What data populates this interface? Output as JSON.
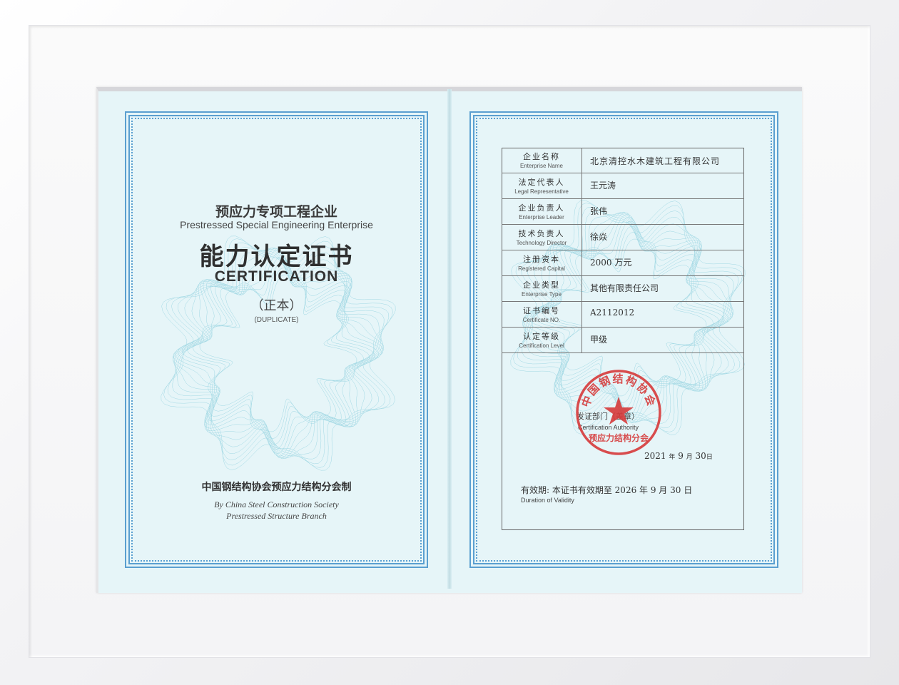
{
  "left_page": {
    "title_cn": "预应力专项工程企业",
    "title_en": "Prestressed Special Engineering Enterprise",
    "heading_cn": "能力认定证书",
    "heading_en": "CERTIFICATION",
    "copy_cn": "（正本）",
    "copy_en": "(DUPLICATE)",
    "issuer_cn": "中国钢结构协会预应力结构分会制",
    "issuer_en_line1": "By China Steel Construction Society",
    "issuer_en_line2": "Prestressed Structure Branch"
  },
  "right_page": {
    "rows": [
      {
        "label_cn": "企业名称",
        "label_en": "Enterprise Name",
        "value": "北京清控水木建筑工程有限公司"
      },
      {
        "label_cn": "法定代表人",
        "label_en": "Legal Representative",
        "value": "王元涛"
      },
      {
        "label_cn": "企业负责人",
        "label_en": "Enterprise Leader",
        "value": "张伟"
      },
      {
        "label_cn": "技术负责人",
        "label_en": "Technology Director",
        "value": "徐焱"
      },
      {
        "label_cn": "注册资本",
        "label_en": "Registered Capital",
        "value": "2000 万元"
      },
      {
        "label_cn": "企业类型",
        "label_en": "Enterprise Type",
        "value": "其他有限责任公司"
      },
      {
        "label_cn": "证书编号",
        "label_en": "Certificate NO.",
        "value": "A2112012"
      },
      {
        "label_cn": "认定等级",
        "label_en": "Certification Level",
        "value": "甲级"
      }
    ],
    "authority_cn": "发证部门（盖章）",
    "authority_en": "Certification Authority",
    "issue_date": {
      "year": "2021",
      "year_unit": "年",
      "month": "9",
      "month_unit": "月",
      "day": "30",
      "day_unit": "日"
    },
    "validity_cn": "有效期: 本证书有效期至  2026 年 9 月 30 日",
    "validity_en": "Duration of Validity"
  },
  "seal": {
    "text_top": "中国钢结构协会",
    "text_bottom": "预应力结构分会",
    "color": "#d63a3a"
  },
  "colors": {
    "paper": "#e6f5f8",
    "border": "#5a9fd0"
  }
}
